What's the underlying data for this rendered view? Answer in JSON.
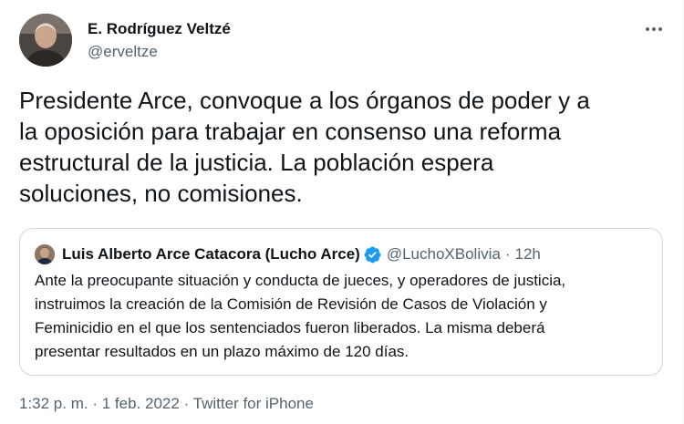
{
  "author": {
    "name": "E. Rodríguez Veltzé",
    "handle": "@erveltze"
  },
  "tweet": {
    "text_lines": [
      "Presidente Arce, convoque a los órganos de poder y a",
      "la oposición para trabajar en consenso una reforma",
      "estructural de la justicia. La población espera",
      "soluciones, no comisiones."
    ]
  },
  "quote": {
    "name": "Luis Alberto Arce Catacora (Lucho Arce)",
    "verified_icon": "verified-badge-icon",
    "handle": "@LuchoXBolivia",
    "separator": "·",
    "time": "12h",
    "text_lines": [
      "Ante la preocupante situación y conducta de jueces, y operadores de justicia,",
      "instruimos la creación de la Comisión de Revisión de Casos de Violación y",
      "Feminicidio en el que los sentenciados fueron liberados. La misma deberá",
      "presentar resultados en un plazo máximo de 120 días."
    ]
  },
  "meta": {
    "time": "1:32 p. m.",
    "sep1": "·",
    "date": "1 feb. 2022",
    "sep2": "·",
    "source": "Twitter for iPhone"
  },
  "icons": {
    "more": "more-options-icon"
  },
  "colors": {
    "text": "#0f1419",
    "secondary": "#536471",
    "border": "#cfd9de",
    "verified": "#1d9bf0"
  }
}
